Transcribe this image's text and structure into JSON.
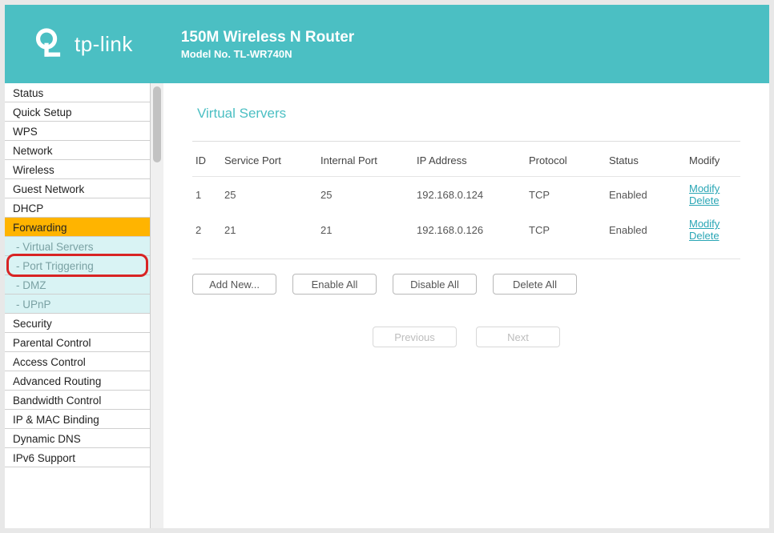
{
  "header": {
    "brand": "tp-link",
    "title": "150M Wireless N Router",
    "model": "Model No. TL-WR740N"
  },
  "sidebar": {
    "items": [
      {
        "label": "Status",
        "kind": "top"
      },
      {
        "label": "Quick Setup",
        "kind": "top"
      },
      {
        "label": "WPS",
        "kind": "top"
      },
      {
        "label": "Network",
        "kind": "top"
      },
      {
        "label": "Wireless",
        "kind": "top"
      },
      {
        "label": "Guest Network",
        "kind": "top"
      },
      {
        "label": "DHCP",
        "kind": "top"
      },
      {
        "label": "Forwarding",
        "kind": "active"
      },
      {
        "label": "- Virtual Servers",
        "kind": "sub"
      },
      {
        "label": "- Port Triggering",
        "kind": "sub-highlight"
      },
      {
        "label": "- DMZ",
        "kind": "sub"
      },
      {
        "label": "- UPnP",
        "kind": "sub"
      },
      {
        "label": "Security",
        "kind": "top"
      },
      {
        "label": "Parental Control",
        "kind": "top"
      },
      {
        "label": "Access Control",
        "kind": "top"
      },
      {
        "label": "Advanced Routing",
        "kind": "top"
      },
      {
        "label": "Bandwidth Control",
        "kind": "top"
      },
      {
        "label": "IP & MAC Binding",
        "kind": "top"
      },
      {
        "label": "Dynamic DNS",
        "kind": "top"
      },
      {
        "label": "IPv6 Support",
        "kind": "top"
      }
    ]
  },
  "page": {
    "title": "Virtual Servers",
    "columns": {
      "id": "ID",
      "service_port": "Service Port",
      "internal_port": "Internal Port",
      "ip_address": "IP Address",
      "protocol": "Protocol",
      "status": "Status",
      "modify": "Modify"
    },
    "rows": [
      {
        "id": "1",
        "service_port": "25",
        "internal_port": "25",
        "ip_address": "192.168.0.124",
        "protocol": "TCP",
        "status": "Enabled",
        "modify": "Modify",
        "delete": "Delete"
      },
      {
        "id": "2",
        "service_port": "21",
        "internal_port": "21",
        "ip_address": "192.168.0.126",
        "protocol": "TCP",
        "status": "Enabled",
        "modify": "Modify",
        "delete": "Delete"
      }
    ],
    "buttons": {
      "add_new": "Add New...",
      "enable_all": "Enable All",
      "disable_all": "Disable All",
      "delete_all": "Delete All",
      "previous": "Previous",
      "next": "Next"
    }
  }
}
